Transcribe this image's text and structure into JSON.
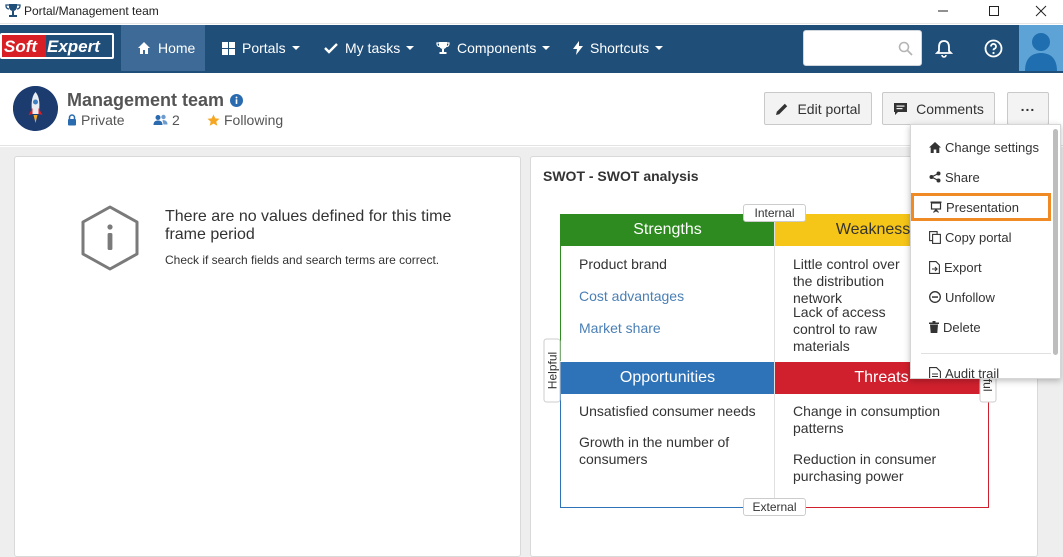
{
  "window": {
    "title": "Portal/Management team",
    "controls": {
      "minimize": "minimize-icon",
      "maximize": "maximize-icon",
      "close": "close-icon"
    }
  },
  "navbar": {
    "logo_text": "SoftExpert",
    "items": [
      {
        "label": "Home",
        "icon": "home-icon",
        "active": true
      },
      {
        "label": "Portals",
        "icon": "portals-icon",
        "dropdown": true
      },
      {
        "label": "My tasks",
        "icon": "check-icon",
        "dropdown": true
      },
      {
        "label": "Components",
        "icon": "trophy-icon",
        "dropdown": true
      },
      {
        "label": "Shortcuts",
        "icon": "bolt-icon",
        "dropdown": true
      }
    ],
    "search": {
      "value": "",
      "placeholder": ""
    }
  },
  "portal": {
    "title": "Management team",
    "privacy": "Private",
    "members": "2",
    "follow_status": "Following",
    "buttons": {
      "edit": "Edit portal",
      "comments": "Comments",
      "more": "..."
    }
  },
  "empty_panel": {
    "title": "There are no values defined for this time frame period",
    "subtitle": "Check if search fields and search terms are correct."
  },
  "swot": {
    "title": "SWOT - SWOT analysis",
    "axes": {
      "top": "Internal",
      "bottom": "External",
      "left": "Helpful",
      "right": "Harmful"
    },
    "quadrants": {
      "strengths": {
        "title": "Strengths",
        "color": "#2e8b1f",
        "items": [
          "Product brand",
          "Cost advantages",
          "Market share"
        ]
      },
      "weaknesses": {
        "title": "Weaknesses",
        "color": "#f5c518",
        "items": [
          "Little control over the distribution network",
          "Lack of access control to raw materials"
        ]
      },
      "opportunities": {
        "title": "Opportunities",
        "color": "#2e72b8",
        "items": [
          "Unsatisfied consumer needs",
          "Growth in the number of consumers"
        ]
      },
      "threats": {
        "title": "Threats",
        "color": "#d0202e",
        "items": [
          "Change in consumption patterns",
          "Reduction in consumer purchasing power"
        ]
      }
    }
  },
  "menu": {
    "items": [
      {
        "label": "Change settings",
        "icon": "home-icon"
      },
      {
        "label": "Share",
        "icon": "share-icon"
      },
      {
        "label": "Presentation",
        "icon": "presentation-icon",
        "highlighted": true
      },
      {
        "label": "Copy portal",
        "icon": "copy-icon"
      },
      {
        "label": "Export",
        "icon": "export-icon"
      },
      {
        "label": "Unfollow",
        "icon": "unfollow-icon"
      },
      {
        "label": "Delete",
        "icon": "trash-icon"
      },
      {
        "label": "Audit trail",
        "icon": "audit-icon"
      }
    ]
  },
  "colors": {
    "navbar": "#1f4e79",
    "navbar_active": "#3d6a96",
    "highlight": "#f08a24"
  }
}
